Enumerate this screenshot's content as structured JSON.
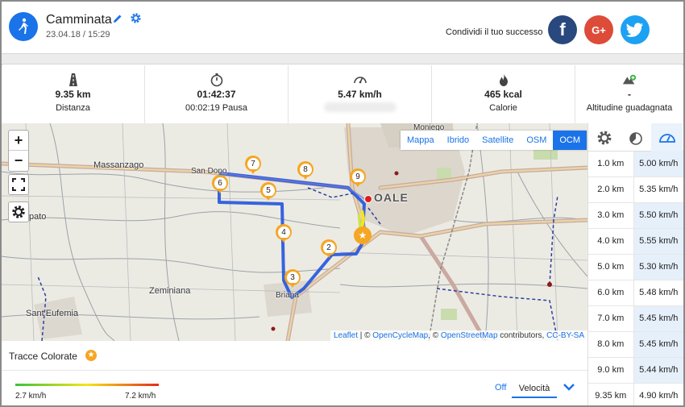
{
  "activity": {
    "title": "Camminata",
    "date": "23.04.18 / 15:29"
  },
  "share": {
    "label": "Condividi il tuo successo",
    "facebook": "f",
    "google": "G+"
  },
  "stats": [
    {
      "icon": "road-icon",
      "value": "9.35 km",
      "label": "Distanza"
    },
    {
      "icon": "stopwatch-icon",
      "value": "01:42:37",
      "label": "00:02:19 Pausa"
    },
    {
      "icon": "speedometer-icon",
      "value": "5.47 km/h",
      "label": ""
    },
    {
      "icon": "flame-icon",
      "value": "465 kcal",
      "label": "Calorie"
    },
    {
      "icon": "mountain-up-icon",
      "value": "-",
      "label": "Altitudine guadagnata"
    }
  ],
  "map": {
    "layers": [
      "Mappa",
      "Ibrido",
      "Satellite",
      "OSM",
      "OCM"
    ],
    "active_layer": "OCM",
    "zoom_in": "+",
    "zoom_out": "−",
    "places": {
      "moniego": "Moniego",
      "massanzago": "Massanzago",
      "san_dono": "San Dono",
      "noale": "OALE",
      "pato": "pato",
      "zeminiana": "Zeminiana",
      "briana": "Briana",
      "santeufemia": "Sant'Eufemia"
    },
    "markers": [
      "2",
      "3",
      "4",
      "5",
      "6",
      "7",
      "8",
      "9"
    ],
    "attribution": {
      "leaflet": "Leaflet",
      "sep1": " | © ",
      "ocm": "OpenCycleMap",
      "sep2": ", © ",
      "osm": "OpenStreetMap",
      "sep3": " contributors, ",
      "license": "CC-BY-SA"
    }
  },
  "splits": [
    {
      "km": "1.0 km",
      "speed": "5.00 km/h"
    },
    {
      "km": "2.0 km",
      "speed": "5.35 km/h"
    },
    {
      "km": "3.0 km",
      "speed": "5.50 km/h"
    },
    {
      "km": "4.0 km",
      "speed": "5.55 km/h"
    },
    {
      "km": "5.0 km",
      "speed": "5.30 km/h"
    },
    {
      "km": "6.0 km",
      "speed": "5.48 km/h"
    },
    {
      "km": "7.0 km",
      "speed": "5.45 km/h"
    },
    {
      "km": "8.0 km",
      "speed": "5.45 km/h"
    },
    {
      "km": "9.0 km",
      "speed": "5.44 km/h"
    },
    {
      "km": "9.35 km",
      "speed": "4.90 km/h"
    }
  ],
  "tracce": {
    "title": "Tracce Colorate",
    "min": "2.7 km/h",
    "max": "7.2 km/h",
    "off": "Off",
    "mode": "Velocità"
  },
  "colors": {
    "accent": "#1a73e8",
    "marker": "#f5a623",
    "route": "#2255dd"
  }
}
